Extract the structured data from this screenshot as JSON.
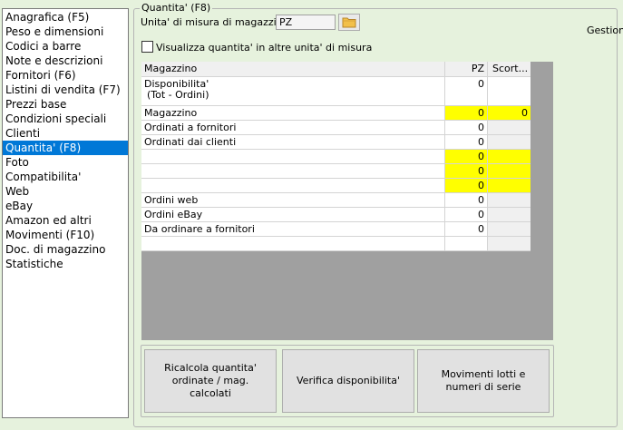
{
  "nav": {
    "items": [
      {
        "label": "Anagrafica (F5)"
      },
      {
        "label": "Peso e dimensioni"
      },
      {
        "label": "Codici a barre"
      },
      {
        "label": "Note e descrizioni"
      },
      {
        "label": "Fornitori (F6)"
      },
      {
        "label": "Listini di vendita (F7)"
      },
      {
        "label": "Prezzi base"
      },
      {
        "label": "Condizioni speciali"
      },
      {
        "label": "Clienti"
      },
      {
        "label": "Quantita' (F8)"
      },
      {
        "label": "Foto"
      },
      {
        "label": "Compatibilita'"
      },
      {
        "label": "Web"
      },
      {
        "label": "eBay"
      },
      {
        "label": "Amazon ed altri"
      },
      {
        "label": "Movimenti (F10)"
      },
      {
        "label": "Doc. di magazzino"
      },
      {
        "label": "Statistiche"
      }
    ],
    "selected": "Quantita' (F8)"
  },
  "panel": {
    "title": "Quantita' (F8)",
    "um_label": "Unita' di misura di magazzino :",
    "um_value": "PZ",
    "checkbox_label": "Visualizza quantita' in altre unita' di misura",
    "checkbox_checked": false,
    "right_label": "Gestione"
  },
  "grid": {
    "headers": {
      "name": "Magazzino",
      "pz": "PZ",
      "scort": "Scort..."
    },
    "rows": [
      {
        "name": "Disponibilita'\n(Tot - Ordini)",
        "pz": "0",
        "scort": "",
        "tall": true
      },
      {
        "name": "Magazzino",
        "pz": "0",
        "scort": "0",
        "highlight": true
      },
      {
        "name": "Ordinati a fornitori",
        "pz": "0",
        "scort": ""
      },
      {
        "name": "Ordinati dai clienti",
        "pz": "0",
        "scort": ""
      },
      {
        "name": "",
        "pz": "0",
        "scort": "",
        "highlight": true,
        "redacted": true
      },
      {
        "name": "",
        "pz": "0",
        "scort": "",
        "highlight": true,
        "redacted": true
      },
      {
        "name": "",
        "pz": "0",
        "scort": "",
        "highlight": true,
        "redacted": true
      },
      {
        "name": "Ordini web",
        "pz": "0",
        "scort": ""
      },
      {
        "name": "Ordini eBay",
        "pz": "0",
        "scort": ""
      },
      {
        "name": "Da ordinare a fornitori",
        "pz": "0",
        "scort": ""
      },
      {
        "name": "",
        "pz": "",
        "scort": ""
      }
    ]
  },
  "buttons": {
    "ricalcola": "Ricalcola quantita' ordinate / mag. calcolati",
    "verifica": "Verifica disponibilita'",
    "movimenti": "Movimenti lotti e numeri di serie"
  },
  "colors": {
    "background": "#e6f2dd",
    "selection": "#0078d7",
    "highlight": "#ffff00",
    "grid_empty": "#a0a0a0"
  },
  "icons": {
    "folder_button": "folder-icon"
  }
}
